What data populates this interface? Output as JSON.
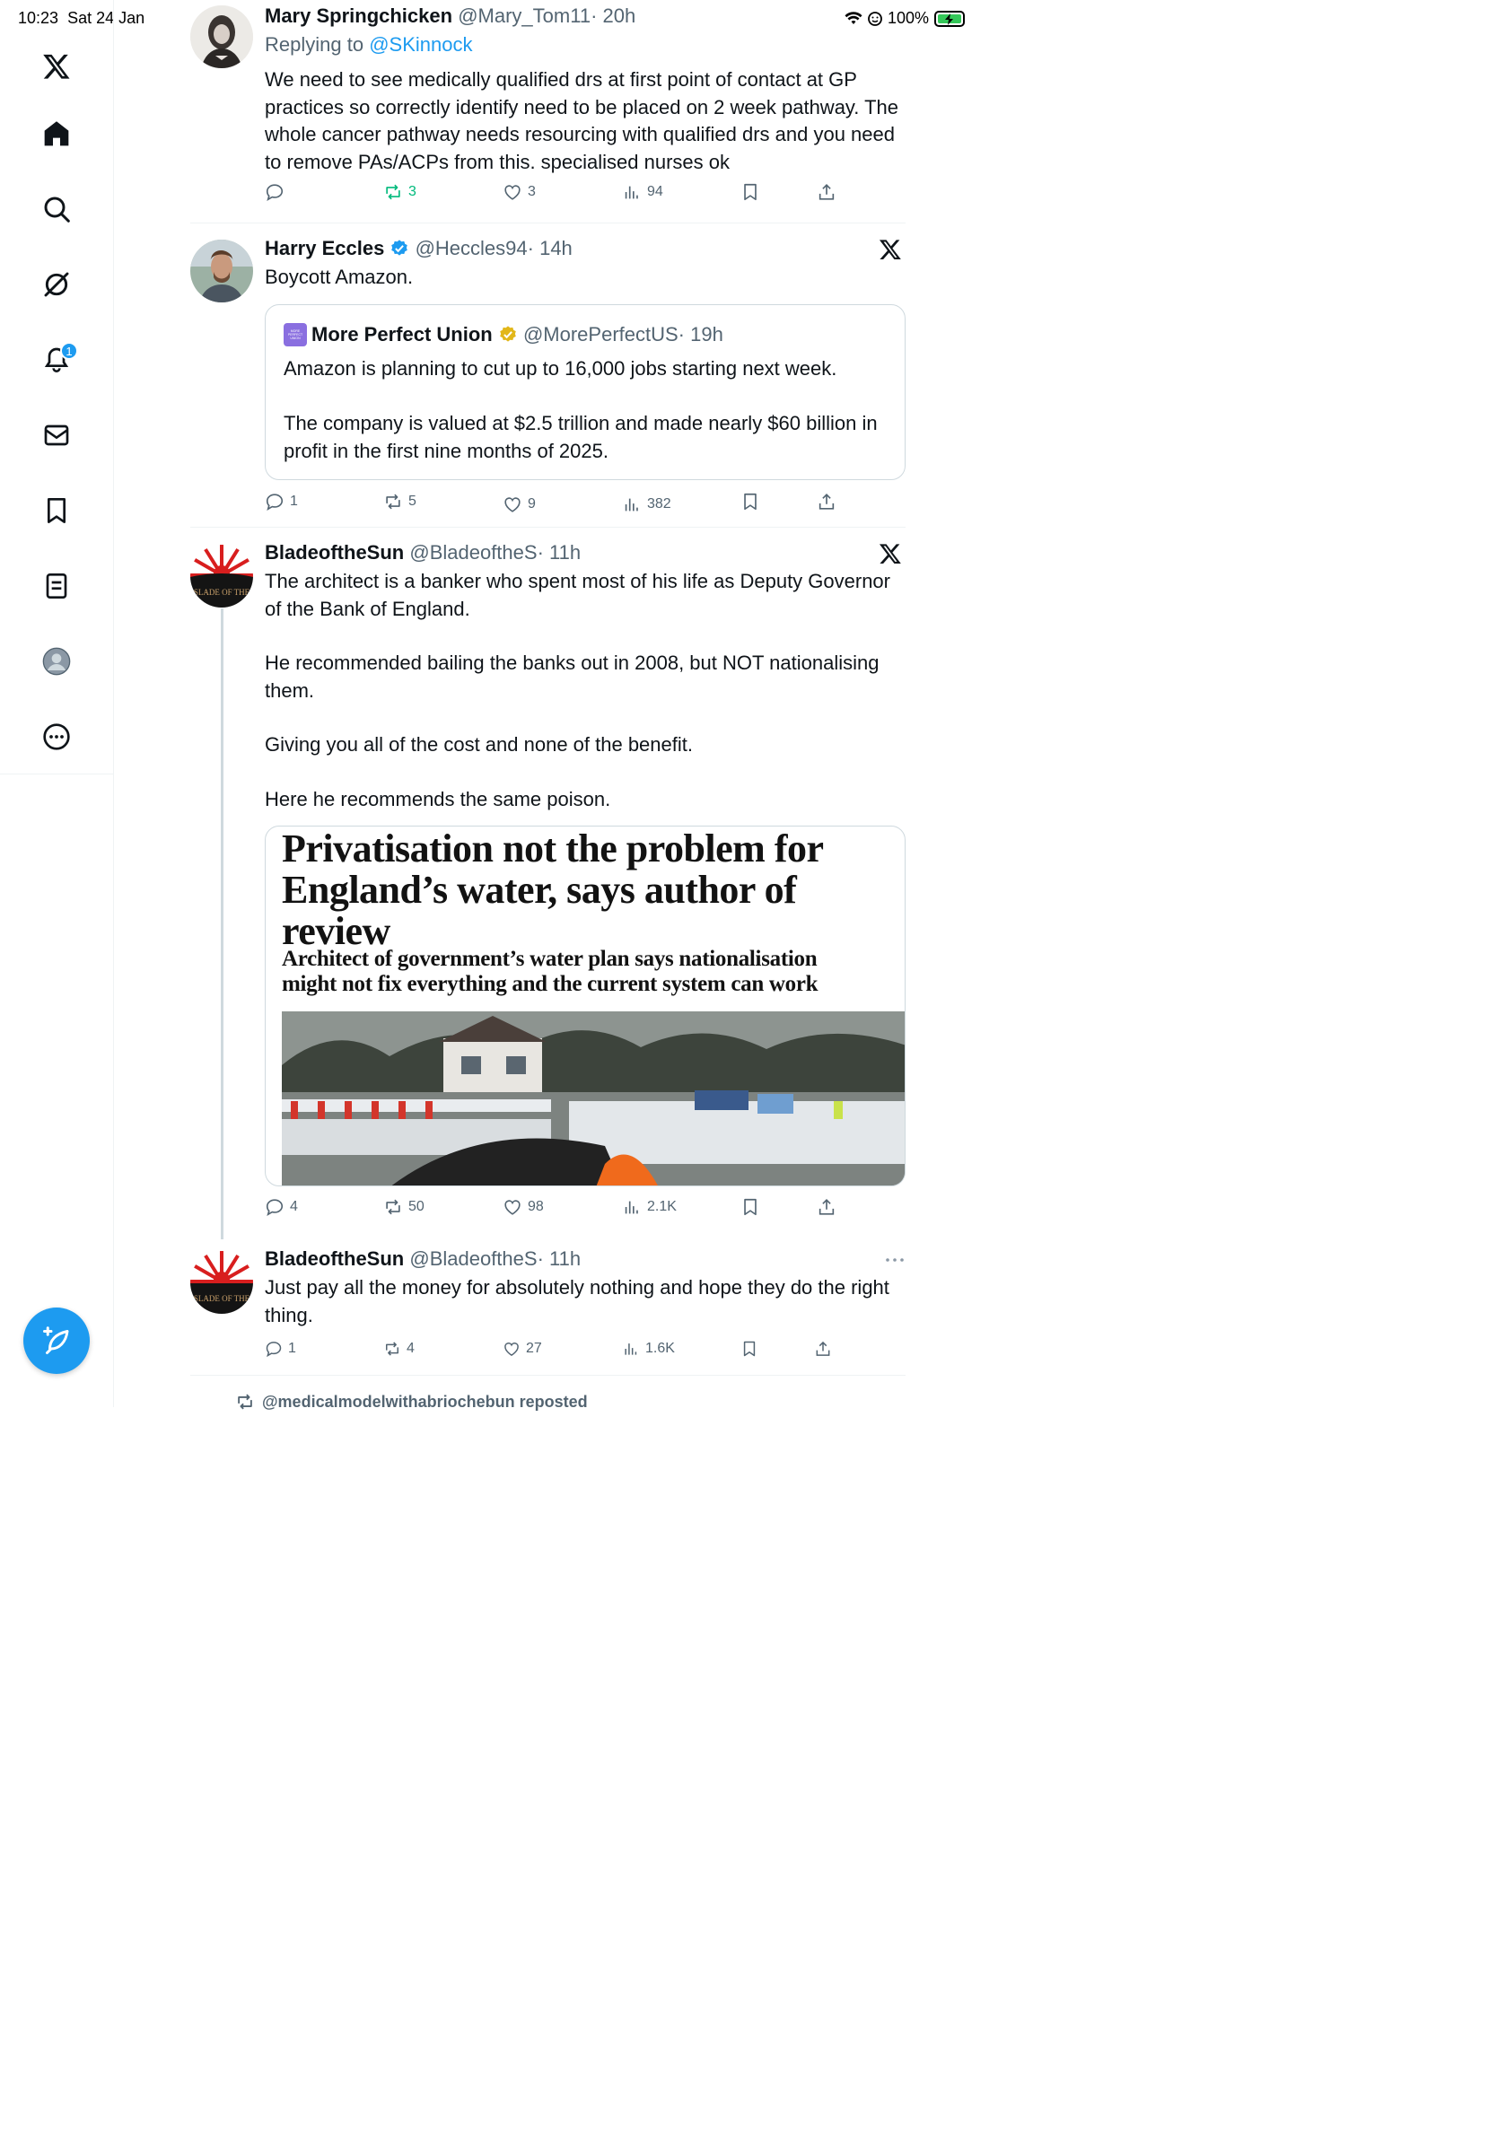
{
  "status_bar": {
    "time": "10:23",
    "date": "Sat 24 Jan",
    "battery": "100%"
  },
  "sidebar": {
    "items": [
      {
        "name": "x-logo-icon"
      },
      {
        "name": "home-icon"
      },
      {
        "name": "search-icon"
      },
      {
        "name": "grok-icon"
      },
      {
        "name": "notifications-icon",
        "badge": "1"
      },
      {
        "name": "messages-icon"
      },
      {
        "name": "bookmarks-icon"
      },
      {
        "name": "lists-icon"
      },
      {
        "name": "profile-icon"
      },
      {
        "name": "more-icon"
      }
    ],
    "compose": "compose-icon"
  },
  "tweets": [
    {
      "name": "Mary Springchicken",
      "handle": "@Mary_Tom11",
      "time": "· 20h",
      "reply_prefix": "Replying to ",
      "reply_to": "@SKinnock",
      "text": "We need to see medically qualified drs at first point of contact at GP practices so correctly identify need to be placed on 2 week pathway. The whole cancer pathway needs resourcing with qualified drs and you need to remove PAs/ACPs from this. specialised nurses ok",
      "replies": "",
      "reposts": "3",
      "likes": "3",
      "views": "94"
    },
    {
      "name": "Harry Eccles",
      "handle": "@Heccles94",
      "time": "· 14h",
      "text": "Boycott Amazon.",
      "quote": {
        "name": "More Perfect Union",
        "handle": "@MorePerfectUS",
        "time": "· 19h",
        "avatar_text": "MORE PERFECT UNION",
        "p1": "Amazon is planning to cut up to 16,000 jobs starting next week.",
        "p2": "The company is valued at $2.5 trillion and made nearly $60 billion in profit in the first nine months of 2025."
      },
      "replies": "1",
      "reposts": "5",
      "likes": "9",
      "views": "382"
    },
    {
      "name": "BladeoftheSun",
      "handle": "@BladeoftheS",
      "time": "· 11h",
      "avatar_text": "SLADE OF THE",
      "p1": "The architect is a banker who spent most of his life as Deputy Governor of the Bank of England.",
      "p2": "He recommended bailing the banks out in 2008, but NOT nationalising them.",
      "p3": "Giving you all of the cost and none of the benefit.",
      "p4": "Here he recommends the same poison.",
      "media": {
        "headline": "Privatisation not the problem for England’s water, says author of review",
        "standfirst": "Architect of government’s water plan says nationalisation might not fix everything and the current system can work"
      },
      "replies": "4",
      "reposts": "50",
      "likes": "98",
      "views": "2.1K"
    },
    {
      "name": "BladeoftheSun",
      "handle": "@BladeoftheS",
      "time": "· 11h",
      "avatar_text": "SLADE OF THE",
      "text": "Just pay all the money for absolutely nothing and hope they do the right thing.",
      "replies": "1",
      "reposts": "4",
      "likes": "27",
      "views": "1.6K"
    }
  ],
  "repost_banner": "@medicalmodelwithabriochebun reposted",
  "colors": {
    "accent": "#1d9bf0",
    "repost_green": "#00ba7c",
    "muted": "#536471"
  }
}
